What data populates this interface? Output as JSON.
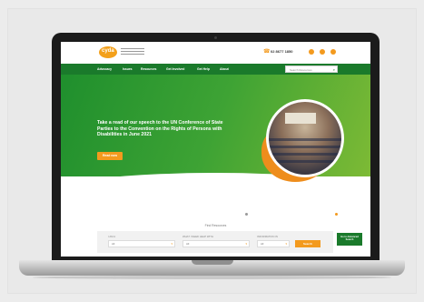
{
  "site": {
    "logo_text": "cyda",
    "phone": "02 8677 1850",
    "nav": [
      "Advocacy",
      "Issues",
      "Resources",
      "Get Involved",
      "Get Help",
      "About"
    ],
    "search_placeholder": "Search Resources",
    "hero_text": "Take a read of our speech to the UN Conference of State Parties to the Convention on the Rights of Persons with Disabilities in June 2021",
    "hero_button": "Read now",
    "find_label": "Find Resources",
    "filters": [
      {
        "label": "I AM A",
        "value": "All"
      },
      {
        "label": "WHAT I NEED HELP WITH",
        "value": "All"
      },
      {
        "label": "INFORMATION IN",
        "value": "All"
      }
    ],
    "search_button": "Search",
    "advanced_button": "Go to Advanced Search"
  },
  "colors": {
    "brand_green": "#1a7a2b",
    "brand_orange": "#f39a1e"
  },
  "icons": {
    "phone": "phone-icon",
    "social": [
      "facebook-icon",
      "twitter-icon",
      "instagram-icon"
    ],
    "search": "search-icon"
  }
}
